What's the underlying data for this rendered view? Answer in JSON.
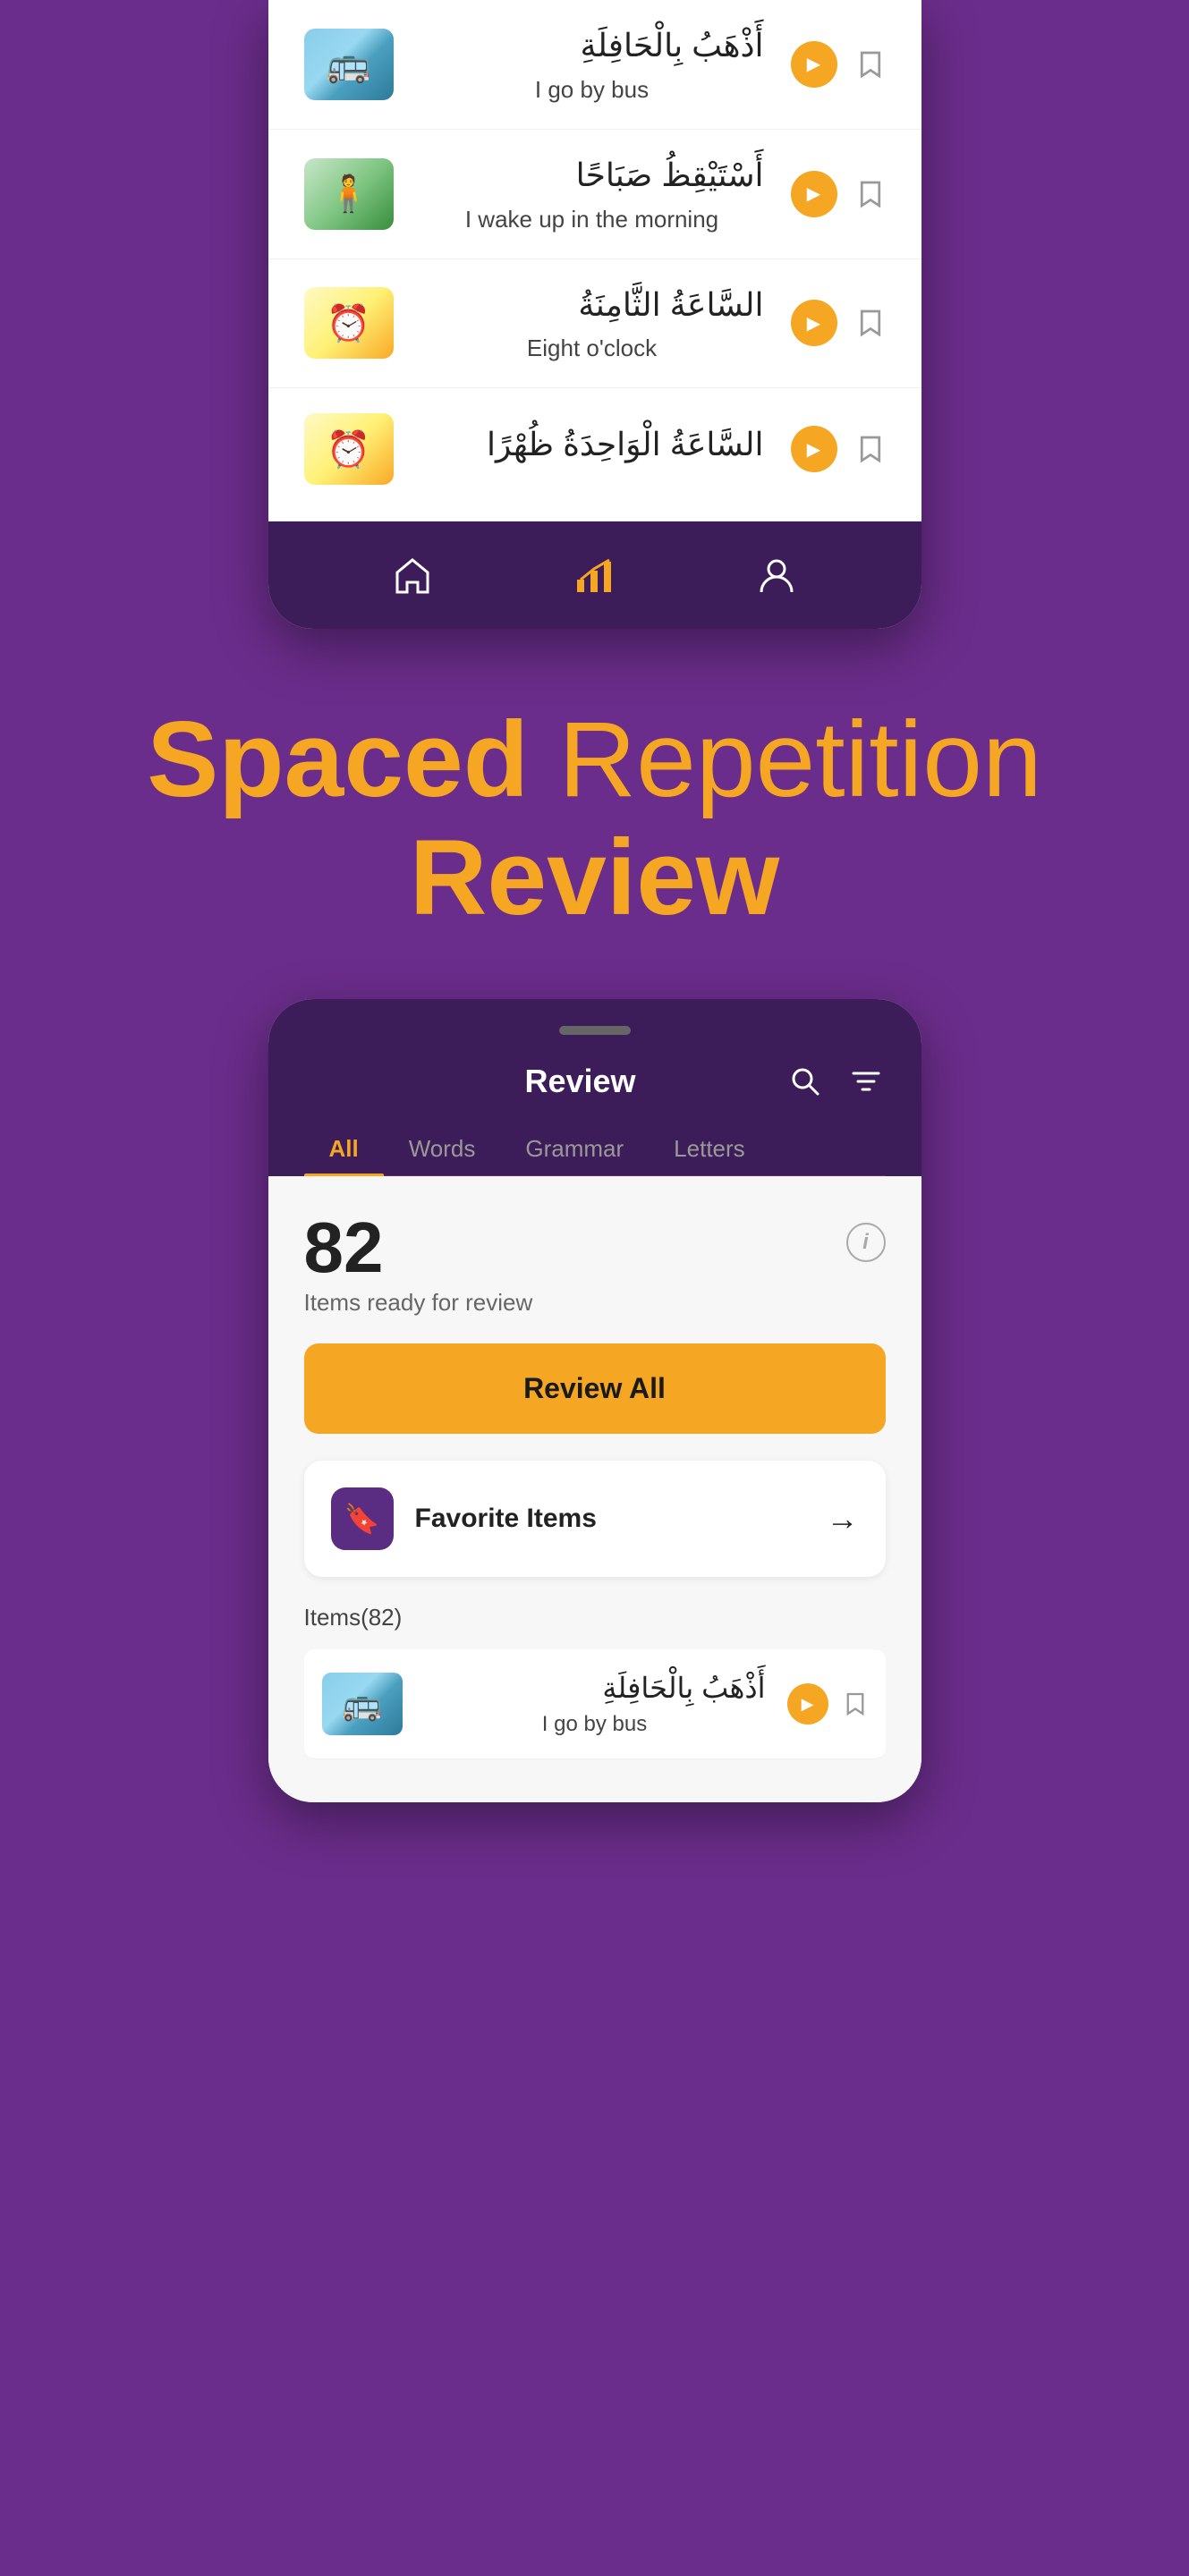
{
  "topPhone": {
    "vocabItems": [
      {
        "id": "bus",
        "arabic": "أَذْهَبُ بِالْحَافِلَةِ",
        "english": "I go by bus",
        "imgType": "bus"
      },
      {
        "id": "morning",
        "arabic": "أَسْتَيْقِظُ صَبَاحًا",
        "english": "I wake up in the morning",
        "imgType": "person"
      },
      {
        "id": "eight",
        "arabic": "السَّاعَةُ الثَّامِنَةُ",
        "english": "Eight o'clock",
        "imgType": "clock"
      },
      {
        "id": "one",
        "arabic": "السَّاعَةُ الْوَاحِدَةُ ظُهْرًا",
        "english": "",
        "imgType": "clock"
      }
    ],
    "nav": {
      "home": "Home",
      "stats": "Stats",
      "profile": "Profile"
    }
  },
  "headline": {
    "bold": "Spaced",
    "rest": " Repetition",
    "line2": "Review"
  },
  "bottomPhone": {
    "title": "Review",
    "tabs": [
      "All",
      "Words",
      "Grammar",
      "Letters"
    ],
    "activeTab": "All",
    "reviewCount": "82",
    "reviewCountLabel": "Items ready for review",
    "reviewAllBtn": "Review All",
    "favoriteItems": {
      "label": "Favorite Items",
      "icon": "🔖"
    },
    "itemsCount": "Items(82)",
    "vocabItems": [
      {
        "id": "bus2",
        "arabic": "أَذْهَبُ بِالْحَافِلَةِ",
        "english": "I go by bus",
        "imgType": "bus"
      }
    ]
  }
}
